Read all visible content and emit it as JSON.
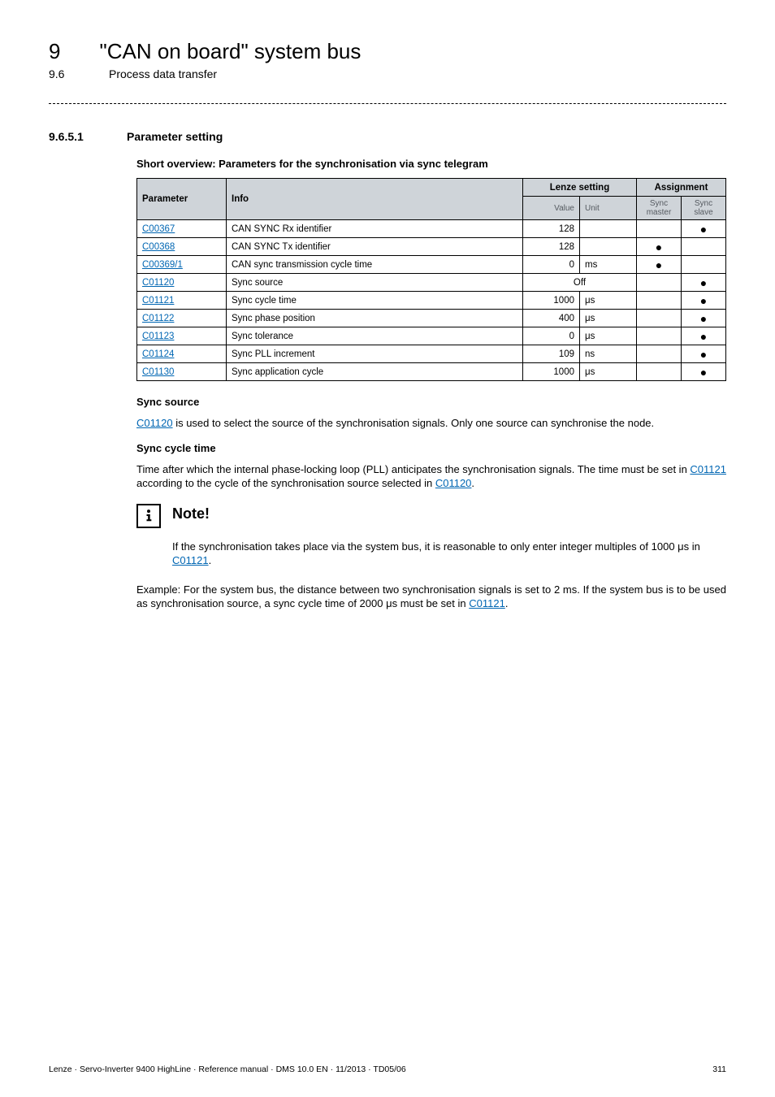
{
  "header": {
    "chapter_number": "9",
    "chapter_title": "\"CAN on board\" system bus",
    "sub_number": "9.6",
    "sub_title": "Process data transfer"
  },
  "section": {
    "number": "9.6.5.1",
    "title": "Parameter setting"
  },
  "overview_heading": "Short overview: Parameters for the synchronisation via sync telegram",
  "table": {
    "columns": {
      "parameter": "Parameter",
      "info": "Info",
      "lenze_setting": "Lenze setting",
      "assignment": "Assignment",
      "value": "Value",
      "unit": "Unit",
      "sync_master": "Sync master",
      "sync_slave": "Sync slave"
    },
    "rows": [
      {
        "param": "C00367",
        "info": "CAN SYNC Rx identifier",
        "value": "128",
        "unit": "",
        "master": "",
        "slave": "●",
        "merge": false
      },
      {
        "param": "C00368",
        "info": "CAN SYNC Tx identifier",
        "value": "128",
        "unit": "",
        "master": "●",
        "slave": "",
        "merge": false
      },
      {
        "param": "C00369/1",
        "info": "CAN sync transmission cycle time",
        "value": "0",
        "unit": "ms",
        "master": "●",
        "slave": "",
        "merge": false
      },
      {
        "param": "C01120",
        "info": "Sync source",
        "value": "Off",
        "unit": "",
        "master": "",
        "slave": "●",
        "merge": true
      },
      {
        "param": "C01121",
        "info": "Sync cycle time",
        "value": "1000",
        "unit": "μs",
        "master": "",
        "slave": "●",
        "merge": false
      },
      {
        "param": "C01122",
        "info": "Sync phase position",
        "value": "400",
        "unit": "μs",
        "master": "",
        "slave": "●",
        "merge": false
      },
      {
        "param": "C01123",
        "info": "Sync tolerance",
        "value": "0",
        "unit": "μs",
        "master": "",
        "slave": "●",
        "merge": false
      },
      {
        "param": "C01124",
        "info": "Sync PLL increment",
        "value": "109",
        "unit": "ns",
        "master": "",
        "slave": "●",
        "merge": false
      },
      {
        "param": "C01130",
        "info": "Sync application cycle",
        "value": "1000",
        "unit": "μs",
        "master": "",
        "slave": "●",
        "merge": false
      }
    ]
  },
  "sync_source": {
    "heading": "Sync source",
    "link": "C01120",
    "text_after": " is used to select the source of the synchronisation signals. Only one source can synchronise the node."
  },
  "sync_cycle": {
    "heading": "Sync cycle time",
    "text_before": "Time after which the internal phase-locking loop (PLL) anticipates the synchronisation signals. The time must be set in ",
    "link1": "C01121",
    "text_mid": " according to the cycle of the synchronisation source selected in ",
    "link2": "C01120",
    "text_end": "."
  },
  "note": {
    "title": "Note!",
    "body_before": "If the synchronisation takes place via the system bus, it is reasonable to only enter integer multiples of 1000 μs in ",
    "body_link": "C01121",
    "body_after": "."
  },
  "example": {
    "text_before": "Example: For the system bus, the distance between two synchronisation signals is set to 2 ms. If the system bus is to be used as synchronisation source, a sync cycle time of 2000 μs must be set in ",
    "link": "C01121",
    "text_after": "."
  },
  "footer": {
    "left": "Lenze · Servo-Inverter 9400 HighLine · Reference manual · DMS 10.0 EN · 11/2013 · TD05/06",
    "right": "311"
  }
}
